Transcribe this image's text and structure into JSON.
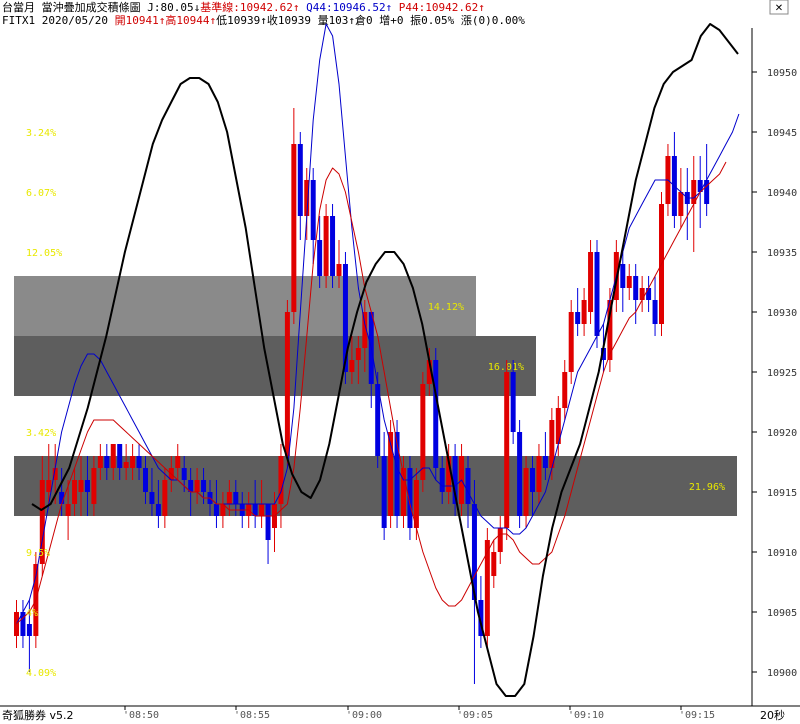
{
  "header": {
    "line1": [
      {
        "text": "台當月 當沖疊加成交積條圖 J:80.05↓",
        "color": "#000000"
      },
      {
        "text": "基準線:10942.62↑",
        "color": "#d00000"
      },
      {
        "text": " Q44:10946.52↑",
        "color": "#0000c8"
      },
      {
        "text": " P44:10942.62↑",
        "color": "#d00000"
      }
    ],
    "line2": [
      {
        "text": "FITX1 2020/05/20 ",
        "color": "#000000"
      },
      {
        "text": "開10941↑",
        "color": "#d00000"
      },
      {
        "text": "高10944↑",
        "color": "#d00000"
      },
      {
        "text": "低10939↑收10939 量103↑倉0 增+0 振0.05% 漲(0)0.00%",
        "color": "#000000"
      }
    ]
  },
  "footer": {
    "app": "奇狐勝券 v5.2",
    "interval": "20秒"
  },
  "window": {
    "close_label": "✕"
  },
  "chart_data": {
    "type": "candlestick",
    "y_ticks": [
      "10950",
      "10945",
      "10940",
      "10935",
      "10930",
      "10925",
      "10920",
      "10915",
      "10910",
      "10905",
      "10900"
    ],
    "x_ticks": [
      "'08:50",
      "'08:55",
      "'09:00",
      "'09:05",
      "'09:10",
      "'09:15"
    ],
    "ylim": [
      10898,
      10955
    ],
    "colors": {
      "up": "#e00000",
      "down": "#0000e0",
      "ma_blue": "#0000cc",
      "ma_red": "#cc0000",
      "osc": "#000000",
      "pct": "#e8e800"
    },
    "volume_profile": [
      {
        "from": 10928,
        "to": 10933,
        "label": "14.12%",
        "color": "#8a8a8a"
      },
      {
        "from": 10923,
        "to": 10928,
        "label": "16.01%",
        "color": "#5e5e5e"
      },
      {
        "from": 10913,
        "to": 10918,
        "label": "21.96%",
        "color": "#5e5e5e"
      }
    ],
    "side_percent_labels": [
      {
        "y": 10945,
        "label": "3.24%"
      },
      {
        "y": 10940,
        "label": "6.07%"
      },
      {
        "y": 10935,
        "label": "12.05%"
      },
      {
        "y": 10920,
        "label": "3.42%"
      },
      {
        "y": 10910,
        "label": "9.5%"
      },
      {
        "y": 10905,
        "label": "4%"
      },
      {
        "y": 10900,
        "label": "4.09%"
      }
    ],
    "candles": [
      {
        "o": 10903,
        "c": 10905,
        "h": 10906,
        "l": 10902
      },
      {
        "o": 10905,
        "c": 10903,
        "h": 10906,
        "l": 10902
      },
      {
        "o": 10904,
        "c": 10903,
        "h": 10906,
        "l": 10900
      },
      {
        "o": 10903,
        "c": 10909,
        "h": 10910,
        "l": 10902
      },
      {
        "o": 10909,
        "c": 10916,
        "h": 10918,
        "l": 10908
      },
      {
        "o": 10915,
        "c": 10916,
        "h": 10919,
        "l": 10914
      },
      {
        "o": 10916,
        "c": 10917,
        "h": 10919,
        "l": 10914
      },
      {
        "o": 10915,
        "c": 10914,
        "h": 10917,
        "l": 10913
      },
      {
        "o": 10913,
        "c": 10914,
        "h": 10916,
        "l": 10911
      },
      {
        "o": 10914,
        "c": 10916,
        "h": 10917,
        "l": 10913
      },
      {
        "o": 10915,
        "c": 10916,
        "h": 10918,
        "l": 10913
      },
      {
        "o": 10916,
        "c": 10915,
        "h": 10918,
        "l": 10913
      },
      {
        "o": 10914,
        "c": 10917,
        "h": 10918,
        "l": 10913
      },
      {
        "o": 10917,
        "c": 10918,
        "h": 10919,
        "l": 10916
      },
      {
        "o": 10918,
        "c": 10917,
        "h": 10919,
        "l": 10916
      },
      {
        "o": 10917,
        "c": 10919,
        "h": 10919,
        "l": 10916
      },
      {
        "o": 10919,
        "c": 10917,
        "h": 10919,
        "l": 10916
      },
      {
        "o": 10917,
        "c": 10917.5,
        "h": 10919,
        "l": 10916
      },
      {
        "o": 10917,
        "c": 10918,
        "h": 10919,
        "l": 10916
      },
      {
        "o": 10918,
        "c": 10917,
        "h": 10919,
        "l": 10916
      },
      {
        "o": 10917,
        "c": 10915,
        "h": 10918,
        "l": 10914
      },
      {
        "o": 10915,
        "c": 10914,
        "h": 10917,
        "l": 10913
      },
      {
        "o": 10914,
        "c": 10913,
        "h": 10916,
        "l": 10912
      },
      {
        "o": 10913,
        "c": 10916,
        "h": 10917,
        "l": 10912
      },
      {
        "o": 10916,
        "c": 10917,
        "h": 10918,
        "l": 10915
      },
      {
        "o": 10917,
        "c": 10918,
        "h": 10919,
        "l": 10916
      },
      {
        "o": 10917,
        "c": 10916,
        "h": 10918,
        "l": 10915
      },
      {
        "o": 10916,
        "c": 10915,
        "h": 10917,
        "l": 10913
      },
      {
        "o": 10915,
        "c": 10916,
        "h": 10917,
        "l": 10914
      },
      {
        "o": 10916,
        "c": 10915,
        "h": 10917,
        "l": 10914
      },
      {
        "o": 10915,
        "c": 10914,
        "h": 10916,
        "l": 10913
      },
      {
        "o": 10914,
        "c": 10913,
        "h": 10916,
        "l": 10912
      },
      {
        "o": 10913,
        "c": 10914,
        "h": 10915,
        "l": 10912
      },
      {
        "o": 10914,
        "c": 10915,
        "h": 10916,
        "l": 10913
      },
      {
        "o": 10915,
        "c": 10914,
        "h": 10916,
        "l": 10913
      },
      {
        "o": 10914,
        "c": 10913,
        "h": 10915,
        "l": 10912
      },
      {
        "o": 10913,
        "c": 10914,
        "h": 10915,
        "l": 10912
      },
      {
        "o": 10914,
        "c": 10913,
        "h": 10916,
        "l": 10912
      },
      {
        "o": 10913,
        "c": 10914,
        "h": 10916,
        "l": 10912
      },
      {
        "o": 10914,
        "c": 10911,
        "h": 10914,
        "l": 10909
      },
      {
        "o": 10912,
        "c": 10914,
        "h": 10915,
        "l": 10910
      },
      {
        "o": 10914,
        "c": 10918,
        "h": 10919,
        "l": 10912
      },
      {
        "o": 10918,
        "c": 10930,
        "h": 10931,
        "l": 10917
      },
      {
        "o": 10930,
        "c": 10944,
        "h": 10947,
        "l": 10929
      },
      {
        "o": 10944,
        "c": 10938,
        "h": 10945,
        "l": 10936
      },
      {
        "o": 10938,
        "c": 10941,
        "h": 10942,
        "l": 10936
      },
      {
        "o": 10941,
        "c": 10936,
        "h": 10942,
        "l": 10934
      },
      {
        "o": 10936,
        "c": 10933,
        "h": 10938,
        "l": 10932
      },
      {
        "o": 10933,
        "c": 10938,
        "h": 10939,
        "l": 10932
      },
      {
        "o": 10938,
        "c": 10933,
        "h": 10939,
        "l": 10932
      },
      {
        "o": 10933,
        "c": 10934,
        "h": 10936,
        "l": 10932
      },
      {
        "o": 10934,
        "c": 10925,
        "h": 10935,
        "l": 10924
      },
      {
        "o": 10925,
        "c": 10926,
        "h": 10928,
        "l": 10924
      },
      {
        "o": 10926,
        "c": 10927,
        "h": 10928,
        "l": 10924
      },
      {
        "o": 10927,
        "c": 10930,
        "h": 10931,
        "l": 10925
      },
      {
        "o": 10930,
        "c": 10924,
        "h": 10930,
        "l": 10922
      },
      {
        "o": 10924,
        "c": 10918,
        "h": 10925,
        "l": 10917
      },
      {
        "o": 10918,
        "c": 10912,
        "h": 10920,
        "l": 10911
      },
      {
        "o": 10913,
        "c": 10920,
        "h": 10921,
        "l": 10912
      },
      {
        "o": 10920,
        "c": 10913,
        "h": 10921,
        "l": 10912
      },
      {
        "o": 10913,
        "c": 10917,
        "h": 10918,
        "l": 10912
      },
      {
        "o": 10917,
        "c": 10912,
        "h": 10918,
        "l": 10911
      },
      {
        "o": 10912,
        "c": 10916,
        "h": 10917,
        "l": 10911
      },
      {
        "o": 10916,
        "c": 10924,
        "h": 10925,
        "l": 10915
      },
      {
        "o": 10924,
        "c": 10926,
        "h": 10927,
        "l": 10923
      },
      {
        "o": 10926,
        "c": 10917,
        "h": 10927,
        "l": 10916
      },
      {
        "o": 10917,
        "c": 10915,
        "h": 10918,
        "l": 10914
      },
      {
        "o": 10915,
        "c": 10918,
        "h": 10919,
        "l": 10914
      },
      {
        "o": 10918,
        "c": 10914,
        "h": 10919,
        "l": 10913
      },
      {
        "o": 10914,
        "c": 10918,
        "h": 10919,
        "l": 10913
      },
      {
        "o": 10917,
        "c": 10914,
        "h": 10918,
        "l": 10912
      },
      {
        "o": 10914,
        "c": 10906,
        "h": 10916,
        "l": 10899
      },
      {
        "o": 10906,
        "c": 10903,
        "h": 10908,
        "l": 10902
      },
      {
        "o": 10903,
        "c": 10911,
        "h": 10912,
        "l": 10902
      },
      {
        "o": 10908,
        "c": 10910,
        "h": 10911,
        "l": 10907
      },
      {
        "o": 10910,
        "c": 10912,
        "h": 10913,
        "l": 10909
      },
      {
        "o": 10912,
        "c": 10925,
        "h": 10926,
        "l": 10911
      },
      {
        "o": 10925,
        "c": 10920,
        "h": 10926,
        "l": 10919
      },
      {
        "o": 10920,
        "c": 10913,
        "h": 10921,
        "l": 10912
      },
      {
        "o": 10913,
        "c": 10917,
        "h": 10918,
        "l": 10912
      },
      {
        "o": 10917,
        "c": 10915,
        "h": 10918,
        "l": 10913
      },
      {
        "o": 10915,
        "c": 10918,
        "h": 10919,
        "l": 10914
      },
      {
        "o": 10918,
        "c": 10917,
        "h": 10920,
        "l": 10916
      },
      {
        "o": 10917,
        "c": 10921,
        "h": 10922,
        "l": 10916
      },
      {
        "o": 10919,
        "c": 10922,
        "h": 10923,
        "l": 10918
      },
      {
        "o": 10922,
        "c": 10925,
        "h": 10926,
        "l": 10921
      },
      {
        "o": 10925,
        "c": 10930,
        "h": 10931,
        "l": 10924
      },
      {
        "o": 10930,
        "c": 10929,
        "h": 10932,
        "l": 10928
      },
      {
        "o": 10929,
        "c": 10931,
        "h": 10932,
        "l": 10928
      },
      {
        "o": 10930,
        "c": 10935,
        "h": 10936,
        "l": 10929
      },
      {
        "o": 10935,
        "c": 10928,
        "h": 10936,
        "l": 10927
      },
      {
        "o": 10927,
        "c": 10926,
        "h": 10929,
        "l": 10925
      },
      {
        "o": 10926,
        "c": 10931,
        "h": 10932,
        "l": 10925
      },
      {
        "o": 10931,
        "c": 10935,
        "h": 10936,
        "l": 10930
      },
      {
        "o": 10934,
        "c": 10932,
        "h": 10935,
        "l": 10930
      },
      {
        "o": 10932,
        "c": 10933,
        "h": 10934,
        "l": 10931
      },
      {
        "o": 10933,
        "c": 10931,
        "h": 10934,
        "l": 10929
      },
      {
        "o": 10931,
        "c": 10932,
        "h": 10933,
        "l": 10930
      },
      {
        "o": 10932,
        "c": 10931,
        "h": 10933,
        "l": 10930
      },
      {
        "o": 10931,
        "c": 10929,
        "h": 10933,
        "l": 10928
      },
      {
        "o": 10929,
        "c": 10939,
        "h": 10940,
        "l": 10928
      },
      {
        "o": 10939,
        "c": 10943,
        "h": 10944,
        "l": 10938
      },
      {
        "o": 10943,
        "c": 10938,
        "h": 10945,
        "l": 10937
      },
      {
        "o": 10938,
        "c": 10940,
        "h": 10942,
        "l": 10937
      },
      {
        "o": 10940,
        "c": 10939,
        "h": 10942,
        "l": 10936
      },
      {
        "o": 10939,
        "c": 10941,
        "h": 10943,
        "l": 10935
      },
      {
        "o": 10941,
        "c": 10940,
        "h": 10943,
        "l": 10937
      },
      {
        "o": 10941,
        "c": 10939,
        "h": 10944,
        "l": 10938
      }
    ],
    "ma_blue": [
      10904,
      10905,
      10906,
      10908,
      10911,
      10914,
      10917,
      10920,
      10922,
      10924,
      10925.5,
      10926.5,
      10926.5,
      10926,
      10925,
      10924,
      10923,
      10922,
      10921,
      10920,
      10919,
      10918,
      10917,
      10916.5,
      10916,
      10916,
      10915.5,
      10915,
      10915,
      10914.5,
      10914.5,
      10914,
      10914,
      10914,
      10914,
      10914,
      10914,
      10914,
      10914,
      10914,
      10914,
      10915,
      10917,
      10922,
      10930,
      10938,
      10946,
      10951,
      10954,
      10953,
      10949,
      10943,
      10937,
      10932,
      10929,
      10927,
      10924,
      10921,
      10919,
      10917,
      10916,
      10916,
      10916.5,
      10917,
      10917,
      10916,
      10915.5,
      10915.5,
      10915.5,
      10916,
      10915,
      10914,
      10913,
      10912.5,
      10912,
      10912,
      10912,
      10911.5,
      10911.5,
      10912,
      10913,
      10914,
      10915,
      10917,
      10919,
      10921,
      10923,
      10925,
      10926,
      10927,
      10928,
      10929,
      10931,
      10933,
      10935,
      10937,
      10938,
      10939,
      10940,
      10941,
      10941,
      10941,
      10940.5,
      10940,
      10939.5,
      10939.5,
      10940,
      10941,
      10942,
      10943,
      10944,
      10945,
      10946.5
    ],
    "ma_red": [
      10904,
      10904.5,
      10905,
      10906,
      10908,
      10910,
      10912,
      10914,
      10915.5,
      10917,
      10918.5,
      10920,
      10921,
      10921,
      10921,
      10921,
      10920.5,
      10920,
      10919.5,
      10919,
      10918.5,
      10918,
      10917.5,
      10917,
      10916.5,
      10916,
      10915.5,
      10915,
      10915,
      10914.5,
      10914.5,
      10914,
      10914,
      10913.5,
      10913.5,
      10913.5,
      10913.5,
      10913,
      10913,
      10913,
      10913,
      10913.5,
      10914,
      10917,
      10922,
      10928,
      10934,
      10938.5,
      10941,
      10942,
      10941.5,
      10940,
      10937.5,
      10935,
      10932,
      10930,
      10928,
      10925,
      10922,
      10919,
      10916.5,
      10914,
      10912,
      10910,
      10908.5,
      10907,
      10906,
      10905.5,
      10905.5,
      10906,
      10907,
      10908,
      10909,
      10910,
      10911,
      10911.5,
      10911.5,
      10911,
      10910,
      10909.5,
      10909,
      10909,
      10909.5,
      10910,
      10911.5,
      10913,
      10915,
      10917,
      10919,
      10921,
      10923,
      10925,
      10926.5,
      10927.5,
      10928.5,
      10929.5,
      10930,
      10931,
      10932,
      10933,
      10934,
      10935,
      10936,
      10937,
      10938,
      10939,
      10940,
      10940.5,
      10941,
      10941.5,
      10942.5
    ],
    "osc": [
      [
        0,
        10914
      ],
      [
        1,
        10913.5
      ],
      [
        2,
        10914
      ],
      [
        4,
        10917
      ],
      [
        6,
        10922
      ],
      [
        8,
        10928
      ],
      [
        10,
        10935
      ],
      [
        12,
        10941
      ],
      [
        13,
        10944
      ],
      [
        14,
        10946
      ],
      [
        15,
        10947.5
      ],
      [
        16,
        10949
      ],
      [
        17,
        10949.5
      ],
      [
        18,
        10949.5
      ],
      [
        19,
        10949
      ],
      [
        20,
        10947.5
      ],
      [
        21,
        10945
      ],
      [
        22,
        10941
      ],
      [
        23,
        10937
      ],
      [
        24,
        10932
      ],
      [
        25,
        10927
      ],
      [
        26,
        10923
      ],
      [
        27,
        10919
      ],
      [
        28,
        10916.5
      ],
      [
        29,
        10915
      ],
      [
        30,
        10914.5
      ],
      [
        31,
        10916
      ],
      [
        32,
        10919
      ],
      [
        33,
        10923
      ],
      [
        34,
        10927
      ],
      [
        35,
        10930
      ],
      [
        36,
        10932.5
      ],
      [
        37,
        10934
      ],
      [
        38,
        10935
      ],
      [
        39,
        10935
      ],
      [
        40,
        10934
      ],
      [
        41,
        10932
      ],
      [
        42,
        10929
      ],
      [
        43,
        10925
      ],
      [
        44,
        10921
      ],
      [
        45,
        10917
      ],
      [
        46,
        10913
      ],
      [
        47,
        10909
      ],
      [
        48,
        10905
      ],
      [
        49,
        10902
      ],
      [
        50,
        10899
      ],
      [
        51,
        10898
      ],
      [
        52,
        10898
      ],
      [
        53,
        10899
      ],
      [
        54,
        10903
      ],
      [
        55,
        10908
      ],
      [
        56,
        10912
      ],
      [
        57,
        10915
      ],
      [
        58,
        10917
      ],
      [
        59,
        10919
      ],
      [
        60,
        10922
      ],
      [
        61,
        10925
      ],
      [
        62,
        10929
      ],
      [
        63,
        10933
      ],
      [
        64,
        10937
      ],
      [
        65,
        10941
      ],
      [
        66,
        10944
      ],
      [
        67,
        10947
      ],
      [
        68,
        10949
      ],
      [
        69,
        10950
      ],
      [
        70,
        10950.5
      ],
      [
        71,
        10951
      ],
      [
        72,
        10953
      ],
      [
        73,
        10954
      ],
      [
        74,
        10953.5
      ],
      [
        75,
        10952.5
      ],
      [
        76,
        10951.5
      ]
    ]
  }
}
